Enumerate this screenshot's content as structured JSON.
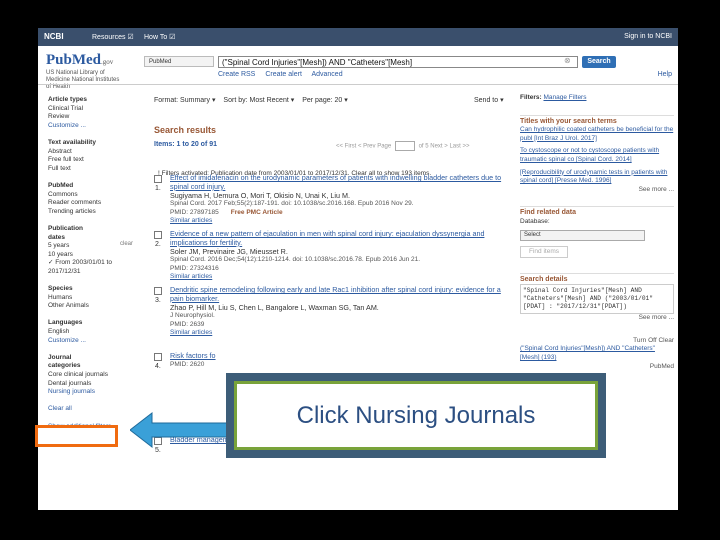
{
  "ncbi": {
    "logo": "NCBI",
    "resources": "Resources ☑",
    "howto": "How To ☑",
    "signin": "Sign in to NCBI"
  },
  "header": {
    "logo": "PubMed",
    "logo_gov": ".gov",
    "subtitle": "US National Library of Medicine National Institutes of Health",
    "database": "PubMed",
    "query": "(\"Spinal Cord Injuries\"[Mesh]) AND \"Catheters\"[Mesh]",
    "search_label": "Search",
    "links": [
      "Create RSS",
      "Create alert",
      "Advanced"
    ],
    "help": "Help"
  },
  "filters": [
    {
      "t": "Article types",
      "k": "hd"
    },
    {
      "t": "Clinical Trial"
    },
    {
      "t": "Review"
    },
    {
      "t": "Customize ...",
      "k": "lnk"
    },
    {
      "t": ""
    },
    {
      "t": "Text availability",
      "k": "hd"
    },
    {
      "t": "Abstract"
    },
    {
      "t": "Free full text"
    },
    {
      "t": "Full text"
    },
    {
      "t": ""
    },
    {
      "t": "PubMed",
      "k": "hd"
    },
    {
      "t": "Commons"
    },
    {
      "t": "Reader comments"
    },
    {
      "t": "Trending articles"
    },
    {
      "t": ""
    },
    {
      "t": "Publication",
      "k": "hd"
    },
    {
      "t": "dates",
      "k": "hd"
    },
    {
      "t": "5 years"
    },
    {
      "t": "10 years"
    },
    {
      "t": "✓ From 2003/01/01 to"
    },
    {
      "t": "   2017/12/31"
    },
    {
      "t": ""
    },
    {
      "t": "Species",
      "k": "hd"
    },
    {
      "t": "Humans"
    },
    {
      "t": "Other Animals"
    },
    {
      "t": ""
    },
    {
      "t": "Languages",
      "k": "hd"
    },
    {
      "t": "English"
    },
    {
      "t": "Customize ...",
      "k": "lnk"
    },
    {
      "t": ""
    },
    {
      "t": "Journal",
      "k": "hd"
    },
    {
      "t": "categories",
      "k": "hd"
    },
    {
      "t": "Core clinical journals"
    },
    {
      "t": "Dental journals"
    },
    {
      "t": "Nursing journals",
      "k": "lnk"
    },
    {
      "t": ""
    },
    {
      "t": "Clear all",
      "k": "lnk"
    },
    {
      "t": ""
    },
    {
      "t": "Show additional filters",
      "k": "lnk"
    }
  ],
  "clear_label": "clear",
  "toolbar": {
    "format": "Format: Summary ▾",
    "sort": "Sort by: Most Recent ▾",
    "perpage": "Per page: 20 ▾",
    "sendto": "Send to ▾"
  },
  "results_title": "Search results",
  "items_count": "Items: 1 to 20 of 91",
  "pager": {
    "first": "<< First",
    "prev": "< Prev",
    "page": "Page",
    "of": "of 5",
    "next": "Next >",
    "last": "Last >>"
  },
  "filter_notice": "! Filters activated: Publication date from 2003/01/01 to 2017/12/31. Clear all to show 193 items.",
  "results": [
    {
      "num": "1.",
      "title": "Effect of imidafenacin on the urodynamic parameters of patients with indwelling bladder catheters due to spinal cord injury.",
      "authors": "Sugiyama H, Uemura O, Mori T, Okisio N, Unai K, Liu M.",
      "citation": "Spinal Cord. 2017 Feb;55(2):187-191. doi: 10.1038/sc.2016.168. Epub 2016 Nov 29.",
      "pmid": "PMID: 27897185",
      "free": "Free PMC Article",
      "similar": "Similar articles"
    },
    {
      "num": "2.",
      "title": "Evidence of a new pattern of ejaculation in men with spinal cord injury: ejaculation dyssynergia and implications for fertility.",
      "authors": "Soler JM, Previnaire JG, Mieusset R.",
      "citation": "Spinal Cord. 2016 Dec;54(12):1210-1214. doi: 10.1038/sc.2016.78. Epub 2016 Jun 21.",
      "pmid": "PMID: 27324316",
      "free": "",
      "similar": "Similar articles"
    },
    {
      "num": "3.",
      "title": "Dendritic spine remodeling following early and late Rac1 inhibition after spinal cord injury: evidence for a pain biomarker.",
      "authors": "Zhao P, Hill M, Liu S, Chen L, Bangalore L, Waxman SG, Tan AM.",
      "citation": "J Neurophysiol.",
      "pmid": "PMID: 2639",
      "free": "",
      "similar": "Similar articles"
    },
    {
      "num": "4.",
      "title": "Risk factors fo",
      "authors": "",
      "citation": "",
      "pmid": "PMID: 2620",
      "free": "",
      "similar": ""
    },
    {
      "num": "5.",
      "title": "Bladder management in individuals with chronic neurogenic lower urinary tract dysfunction.",
      "authors": "",
      "citation": "",
      "pmid": "",
      "free": "",
      "similar": ""
    }
  ],
  "right": {
    "filters_label": "Filters:",
    "filters_link": "Manage Filters",
    "titles_head": "Titles with your search terms",
    "titles": [
      "Can hydrophilic coated catheters be beneficial for the publ [Int Braz J Urol. 2017]",
      "To cystoscope or not to cystoscope patients with traumatic spinal co [Spinal Cord. 2014]",
      "[Reproducibility of urodynamic tests in patients with spinal cord] [Presse Med. 1996]"
    ],
    "see_more": "See more ...",
    "related_head": "Find related data",
    "database_label": "Database:",
    "database_value": "Select",
    "find_items": "Find items",
    "details_head": "Search details",
    "details_text": "\"Spinal Cord Injuries\"[Mesh] AND \"Catheters\"[Mesh] AND (\"2003/01/01\"[PDAT] : \"2017/12/31\"[PDAT])",
    "see_more2": "See more ...",
    "recent_turn_off": "Turn Off  Clear",
    "recent_query": "(\"Spinal Cord Injuries\"[Mesh]) AND \"Catheters\"[Mesh] (193)",
    "recent_pubmed": "PubMed"
  },
  "callout": {
    "text": "Click Nursing Journals"
  },
  "colors": {
    "highlight": "#f06b10",
    "callout_border": "#79a33a",
    "callout_frame": "#3d5d78",
    "arrow": "#3aa0d8"
  }
}
